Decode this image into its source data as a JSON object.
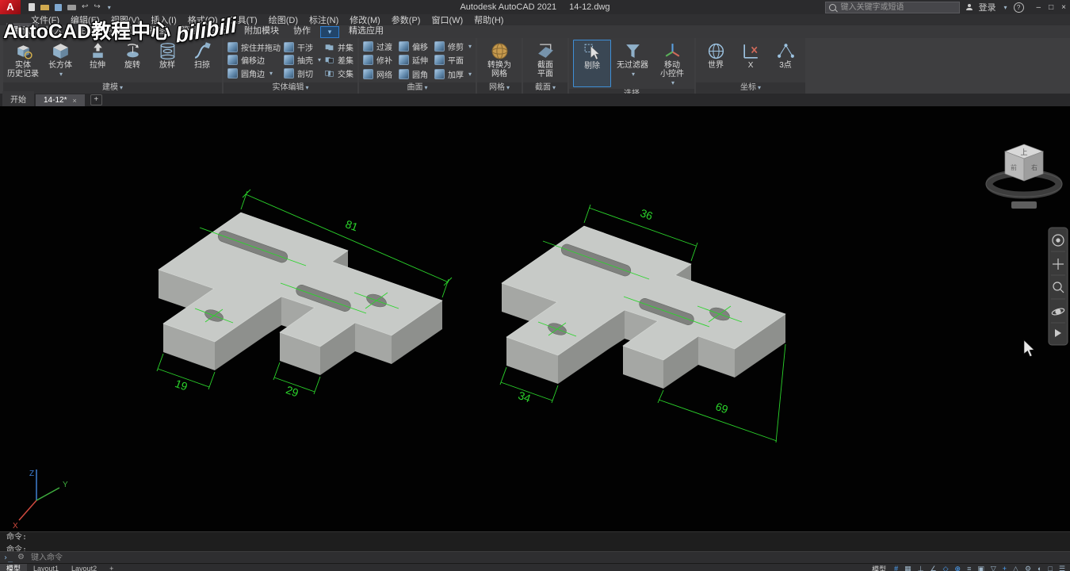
{
  "title_bar": {
    "app_logo": "A",
    "app_title": "Autodesk AutoCAD 2021",
    "doc_title": "14-12.dwg",
    "search_placeholder": "键入关键字或短语",
    "signin": "登录"
  },
  "menu_bar": {
    "items": [
      "文件(F)",
      "编辑(E)",
      "视图(V)",
      "插入(I)",
      "格式(O)",
      "工具(T)",
      "绘图(D)",
      "标注(N)",
      "修改(M)",
      "参数(P)",
      "窗口(W)",
      "帮助(H)"
    ]
  },
  "watermark": {
    "text": "AutoCAD教程中心",
    "logo": "bilibili"
  },
  "ribbon": {
    "tabs": [
      "默认",
      "插入",
      "注释",
      "参数化",
      "视图",
      "管理",
      "输出",
      "附加模块",
      "协作",
      "精选应用"
    ],
    "modeling": {
      "history": "实体\n历史记录",
      "buttons": [
        "长方体",
        "拉伸",
        "旋转",
        "放样",
        "扫掠"
      ],
      "footer": "建模"
    },
    "solid_edit": {
      "col1": [
        "按住并拖动",
        "偏移边",
        "圆角边"
      ],
      "col2": [
        "干涉",
        "抽壳",
        "剖切"
      ],
      "col3": [
        "并集",
        "差集",
        "交集"
      ],
      "footer": "实体编辑"
    },
    "surface": {
      "cells": [
        "过渡",
        "偏移",
        "修剪",
        "修补",
        "延伸",
        "平面",
        "网络",
        "圆角",
        "加厚"
      ],
      "footer": "曲面"
    },
    "mesh": {
      "button": "转换为\n网格",
      "footer": "网格"
    },
    "section": {
      "button": "截面\n平面",
      "footer": "截面"
    },
    "selection": {
      "cull": "剔除",
      "filter": "无过滤器",
      "gizmo": "移动\n小控件",
      "footer": "选择"
    },
    "coords": {
      "buttons": [
        "世界",
        "X",
        "3点"
      ],
      "footer": "坐标"
    }
  },
  "file_tabs": {
    "start": "开始",
    "doc": "14-12*",
    "close": "×",
    "add": "+"
  },
  "viewport": {
    "dims": {
      "left": [
        "81",
        "19",
        "29"
      ],
      "right": [
        "36",
        "34",
        "69"
      ]
    },
    "viewcube": {
      "top": "上",
      "front": "前",
      "right": "右"
    },
    "ucs": {
      "x": "X",
      "y": "Y",
      "z": "Z"
    }
  },
  "command": {
    "history": [
      "命令:",
      "命令:"
    ],
    "placeholder": "键入命令"
  },
  "status_bar": {
    "layout_tabs": [
      "模型",
      "Layout1",
      "Layout2",
      "+"
    ],
    "space_toggle": "模型",
    "icons": [
      "#",
      "▦",
      "⊥",
      "∠",
      "◇",
      "⊕",
      "≡",
      "▣",
      "▽",
      "+",
      "△",
      "⚙",
      "◐",
      "□",
      "☰"
    ]
  }
}
